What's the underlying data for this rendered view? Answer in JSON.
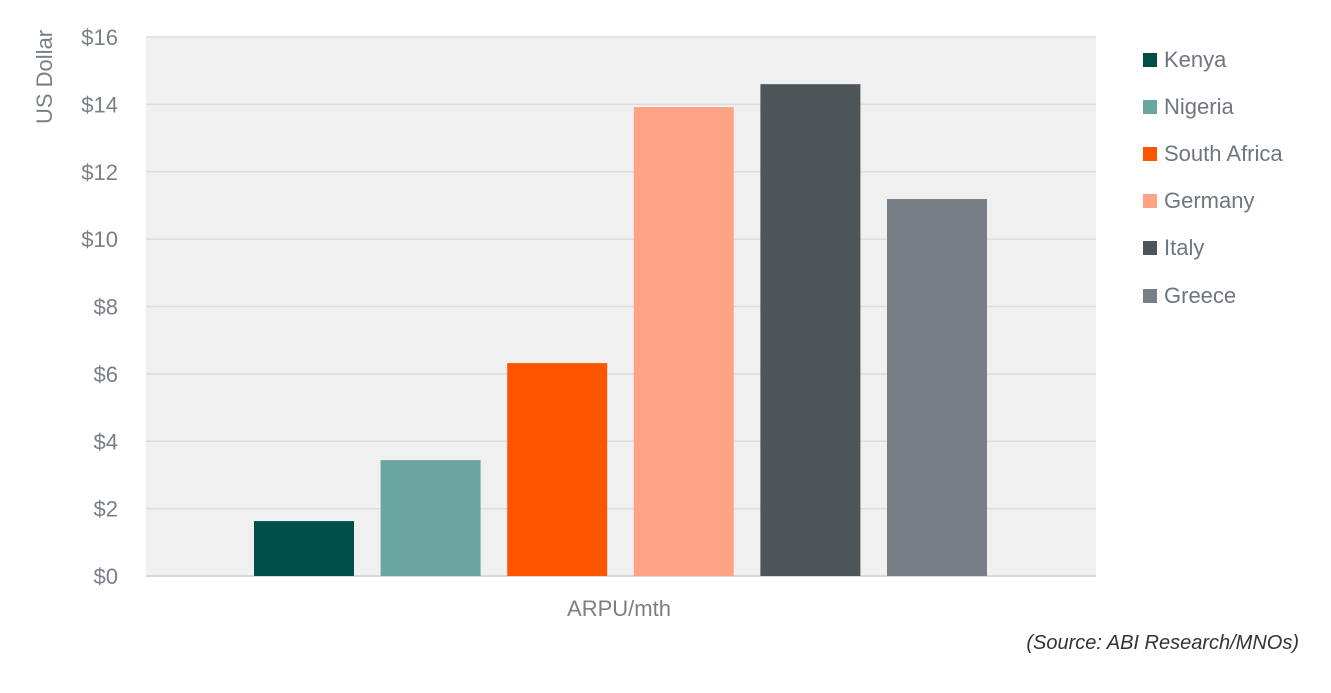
{
  "chart_data": {
    "type": "bar",
    "title": "",
    "xlabel": "ARPU/mth",
    "ylabel": "US Dollar",
    "ylim": [
      0,
      16
    ],
    "yticks": [
      0,
      2,
      4,
      6,
      8,
      10,
      12,
      14,
      16
    ],
    "ytick_labels": [
      "$0",
      "$2",
      "$4",
      "$6",
      "$8",
      "$10",
      "$12",
      "$14",
      "$16"
    ],
    "categories": [
      "ARPU/mth"
    ],
    "series": [
      {
        "name": "Kenya",
        "values": [
          1.63
        ],
        "color": "#004f4a"
      },
      {
        "name": "Nigeria",
        "values": [
          3.44
        ],
        "color": "#6aa5a0"
      },
      {
        "name": "South Africa",
        "values": [
          6.32
        ],
        "color": "#ff5500"
      },
      {
        "name": "Germany",
        "values": [
          13.92
        ],
        "color": "#ffa386"
      },
      {
        "name": "Italy",
        "values": [
          14.6
        ],
        "color": "#4d5559"
      },
      {
        "name": "Greece",
        "values": [
          11.19
        ],
        "color": "#777e85"
      }
    ],
    "grid": true,
    "legend_position": "right",
    "plot_background": "#f0f0f0",
    "source": "(Source: ABI Research/MNOs)"
  }
}
